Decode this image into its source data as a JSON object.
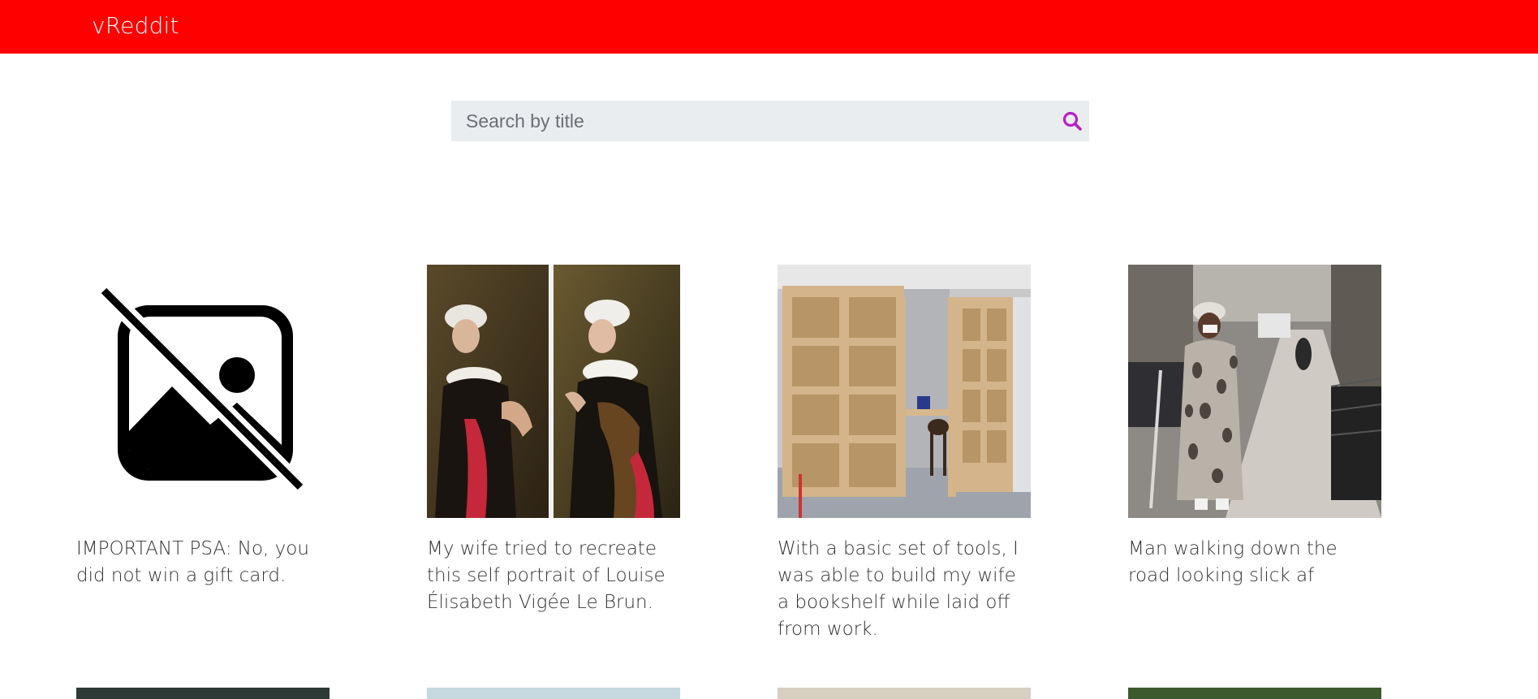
{
  "app": {
    "brand": "vReddit"
  },
  "search": {
    "placeholder": "Search by title",
    "value": ""
  },
  "posts": [
    {
      "title": "IMPORTANT PSA: No, you did not win a gift card.",
      "image": "broken-image-icon"
    },
    {
      "title": "My wife tried to recreate this self portrait of Louise Élisabeth Vigée Le Brun.",
      "image": "portrait-comparison"
    },
    {
      "title": "With a basic set of tools, I was able to build my wife a bookshelf while laid off from work.",
      "image": "bookshelf-photo"
    },
    {
      "title": "Man walking down the road looking slick af",
      "image": "street-photo"
    }
  ],
  "colors": {
    "header": "#ff0000",
    "search_bg": "#e9edf0",
    "search_icon": "#b620c8",
    "caption_text": "#333333"
  }
}
